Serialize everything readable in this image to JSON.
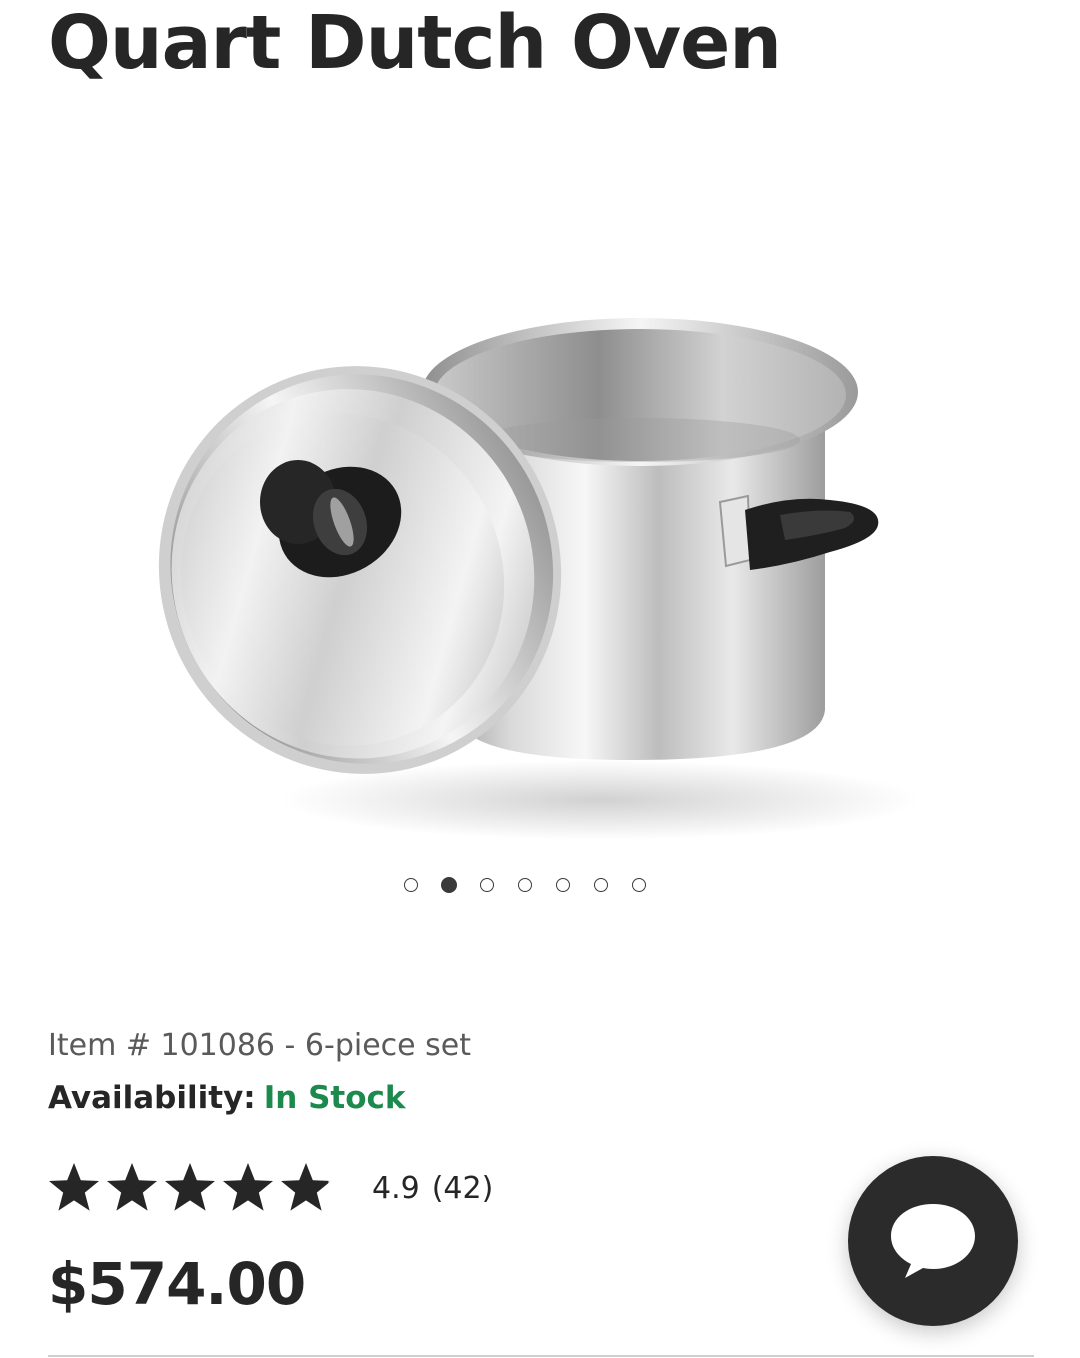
{
  "product": {
    "title": "Quart Dutch Oven",
    "image_alt": "stainless-steel-dutch-oven-with-lid",
    "item_line": "Item # 101086 - 6-piece set",
    "availability_label": "Availability:",
    "availability_status": "In Stock",
    "rating_value": "4.9",
    "rating_count": "(42)",
    "rating_stars": 4.9,
    "price": "$574.00"
  },
  "carousel": {
    "total_images": 7,
    "active_index": 1
  },
  "chat": {
    "icon": "speech-bubble-icon"
  },
  "colors": {
    "text": "#262626",
    "in_stock": "#1b8a4c",
    "chat_button": "#2b2b2b"
  }
}
